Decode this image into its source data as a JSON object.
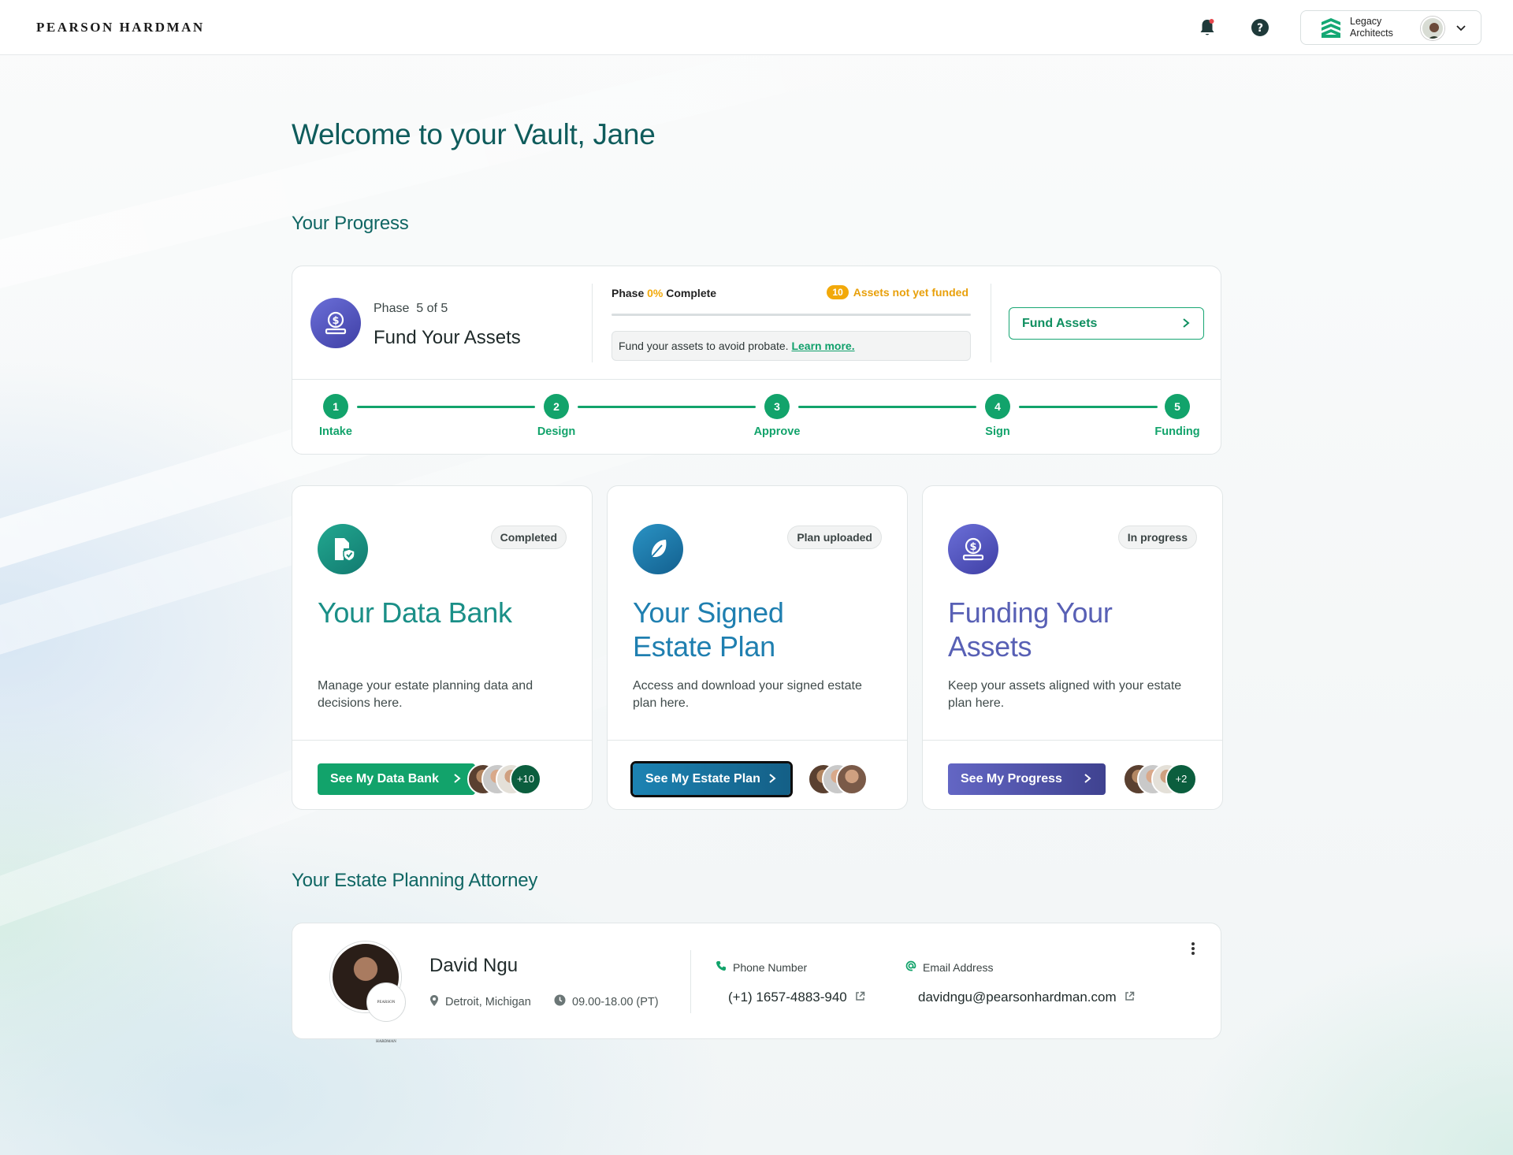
{
  "header": {
    "logo": "Pearson Hardman",
    "notification_icon": "bell-icon",
    "help_icon": "help-icon",
    "org_name": "Legacy Architects"
  },
  "welcome": "Welcome to your Vault, Jane",
  "progress": {
    "section_title": "Your Progress",
    "phase_label": "Phase",
    "phase_value": "5 of 5",
    "phase_title": "Fund Your Assets",
    "phase_word": "Phase",
    "phase_percent": "0%",
    "phase_complete": "Complete",
    "completion_fraction": 0,
    "badge_count": "10",
    "badge_text": "Assets not yet funded",
    "note_text": "Fund your assets to avoid probate.",
    "note_link": "Learn more.",
    "fund_button": "Fund Assets",
    "steps": [
      {
        "num": "1",
        "label": "Intake"
      },
      {
        "num": "2",
        "label": "Design"
      },
      {
        "num": "3",
        "label": "Approve"
      },
      {
        "num": "4",
        "label": "Sign"
      },
      {
        "num": "5",
        "label": "Funding"
      }
    ]
  },
  "cards": [
    {
      "status": "Completed",
      "title": "Your Data Bank",
      "description": "Manage your estate planning data and decisions here.",
      "button": "See My Data Bank",
      "more_count": "+10",
      "color": "#1a8f87",
      "icon": "document-shield-icon"
    },
    {
      "status": "Plan uploaded",
      "title": "Your Signed Estate Plan",
      "description": "Access and download your signed estate plan here.",
      "button": "See My Estate Plan",
      "color": "#1f7fb0",
      "icon": "feather-icon"
    },
    {
      "status": "In progress",
      "title": "Funding Your Assets",
      "description": "Keep your assets aligned with your estate plan here.",
      "button": "See My Progress",
      "more_count": "+2",
      "color": "#5860b5",
      "icon": "money-bag-icon"
    }
  ],
  "attorney": {
    "section_title": "Your Estate Planning Attorney",
    "name": "David Ngu",
    "location": "Detroit, Michigan",
    "hours": "09.00-18.00 (PT)",
    "phone_label": "Phone Number",
    "phone": "(+1) 1657-4883-940",
    "email_label": "Email Address",
    "email": "davidngu@pearsonhardman.com",
    "firm_badge": "Pearson Hardman"
  },
  "colors": {
    "accent_green": "#12a36b",
    "brand_teal": "#0f5c5c",
    "warning": "#f2a90a"
  }
}
